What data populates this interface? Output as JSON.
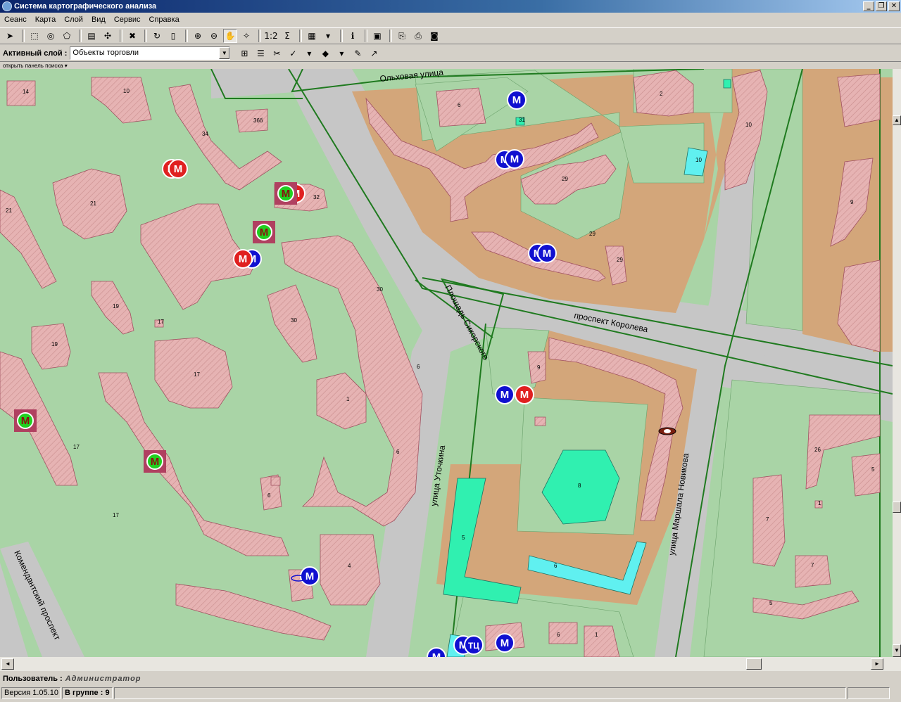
{
  "window": {
    "title": "Система картографического анализа",
    "btn_min": "_",
    "btn_restore": "❐",
    "btn_close": "✕"
  },
  "menu": [
    {
      "label": "Сеанс"
    },
    {
      "label": "Карта"
    },
    {
      "label": "Слой"
    },
    {
      "label": "Вид"
    },
    {
      "label": "Сервис"
    },
    {
      "label": "Справка"
    }
  ],
  "toolbar": {
    "icons": [
      {
        "name": "pointer-icon",
        "glyph": "➤",
        "selected": false
      },
      {
        "name": "select-rect-icon",
        "glyph": "⬚",
        "selected": false
      },
      {
        "name": "select-circle-icon",
        "glyph": "◎",
        "selected": false
      },
      {
        "name": "select-poly-icon",
        "glyph": "⬠",
        "selected": false
      },
      {
        "name": "layers-icon",
        "glyph": "▤",
        "selected": false
      },
      {
        "name": "expand-icon",
        "glyph": "✣",
        "selected": false
      },
      {
        "name": "clear-selection-icon",
        "glyph": "✖",
        "selected": false
      },
      {
        "name": "refresh-icon",
        "glyph": "↻",
        "selected": false
      },
      {
        "name": "blank-page-icon",
        "glyph": "▯",
        "selected": false
      },
      {
        "name": "zoom-in-icon",
        "glyph": "⊕",
        "selected": false
      },
      {
        "name": "zoom-out-icon",
        "glyph": "⊖",
        "selected": false
      },
      {
        "name": "hand-pan-icon",
        "glyph": "✋",
        "selected": true
      },
      {
        "name": "magic-wand-icon",
        "glyph": "✧",
        "selected": false
      },
      {
        "name": "ruler-icon",
        "glyph": "1:2",
        "selected": false
      },
      {
        "name": "sum-icon",
        "glyph": "Σ",
        "selected": false
      },
      {
        "name": "grid-icon",
        "glyph": "▦",
        "selected": false
      },
      {
        "name": "dropdown-arrow-icon",
        "glyph": "▾",
        "selected": false
      },
      {
        "name": "info-icon",
        "glyph": "ℹ",
        "selected": false
      },
      {
        "name": "legend-icon",
        "glyph": "▣",
        "selected": false
      },
      {
        "name": "export-icon",
        "glyph": "⎘",
        "selected": false
      },
      {
        "name": "print-icon",
        "glyph": "⎙",
        "selected": false
      },
      {
        "name": "camera-icon",
        "glyph": "◙",
        "selected": false
      }
    ],
    "active_layer_label": "Активный слой :",
    "active_layer_value": "Объекты торговли",
    "icons2": [
      {
        "name": "layer-add-icon",
        "glyph": "⊞"
      },
      {
        "name": "layer-list-icon",
        "glyph": "☰"
      },
      {
        "name": "scissors-icon",
        "glyph": "✂"
      },
      {
        "name": "check-spell-icon",
        "glyph": "✓"
      },
      {
        "name": "dropdown-arrow-icon",
        "glyph": "▾"
      },
      {
        "name": "shapes-icon",
        "glyph": "◆"
      },
      {
        "name": "dropdown-arrow-icon",
        "glyph": "▾"
      },
      {
        "name": "comment-icon",
        "glyph": "✎"
      },
      {
        "name": "chart-edit-icon",
        "glyph": "↗"
      }
    ],
    "search_panel": "открыть панель поиска ▾"
  },
  "map": {
    "colors": {
      "grass": "#a9d4a6",
      "building": "#e4b2b2",
      "road": "#c6c6c6",
      "plot": "#d3a67a",
      "boundary": "#1f7a1f",
      "blue_marker": "#1010d0",
      "red_marker": "#e02020",
      "green_marker": "#20d020"
    },
    "streets": [
      {
        "text": "Ольховая улица"
      },
      {
        "text": "проспект Королева"
      },
      {
        "text": "Площадь Сикорского"
      },
      {
        "text": "улица Уточкина"
      },
      {
        "text": "улица Маршала Новикова"
      },
      {
        "text": "Комендантский проспект"
      }
    ],
    "buildings": [
      {
        "n": "14"
      },
      {
        "n": "10"
      },
      {
        "n": "34"
      },
      {
        "n": "36б"
      },
      {
        "n": "21"
      },
      {
        "n": "21"
      },
      {
        "n": "32"
      },
      {
        "n": "19"
      },
      {
        "n": "17"
      },
      {
        "n": "19"
      },
      {
        "n": "30"
      },
      {
        "n": "30"
      },
      {
        "n": "17"
      },
      {
        "n": "6"
      },
      {
        "n": "6"
      },
      {
        "n": "17"
      },
      {
        "n": "17"
      },
      {
        "n": "6"
      },
      {
        "n": "4"
      },
      {
        "n": "6"
      },
      {
        "n": "2"
      },
      {
        "n": "10"
      },
      {
        "n": "10"
      },
      {
        "n": "29"
      },
      {
        "n": "29"
      },
      {
        "n": "9"
      },
      {
        "n": "9"
      },
      {
        "n": "5"
      },
      {
        "n": "8"
      },
      {
        "n": "5"
      },
      {
        "n": "6"
      },
      {
        "n": "26"
      },
      {
        "n": "7"
      },
      {
        "n": "7"
      },
      {
        "n": "5"
      },
      {
        "n": "31"
      },
      {
        "n": "29"
      },
      {
        "n": "1"
      },
      {
        "n": "1"
      },
      {
        "n": "6"
      },
      {
        "n": "1"
      }
    ],
    "markers": [
      {
        "label": "M",
        "type": "blue"
      },
      {
        "label": "M",
        "type": "blue"
      },
      {
        "label": "M",
        "type": "blue"
      },
      {
        "label": "M",
        "type": "blue"
      },
      {
        "label": "M",
        "type": "blue"
      },
      {
        "label": "M",
        "type": "blue"
      },
      {
        "label": "M",
        "type": "red"
      },
      {
        "label": "M",
        "type": "blue"
      },
      {
        "label": "M",
        "type": "blue"
      },
      {
        "label": "TЦ",
        "type": "blue"
      },
      {
        "label": "M",
        "type": "blue"
      },
      {
        "label": "M",
        "type": "blue"
      },
      {
        "label": "M",
        "type": "red"
      },
      {
        "label": "M",
        "type": "red"
      },
      {
        "label": "M",
        "type": "green"
      },
      {
        "label": "M",
        "type": "green"
      },
      {
        "label": "M",
        "type": "green"
      },
      {
        "label": "M",
        "type": "blue"
      },
      {
        "label": "M",
        "type": "red"
      },
      {
        "label": "M",
        "type": "green"
      },
      {
        "label": "M",
        "type": "red"
      }
    ]
  },
  "scrollbars": {
    "up": "▲",
    "down": "▼",
    "left": "◄",
    "right": "►"
  },
  "status": {
    "user_label": "Пользователь :",
    "user_value": "Администратор",
    "version": "Версия 1.05.10",
    "group_label": "В группе : 9",
    "extra": ""
  }
}
